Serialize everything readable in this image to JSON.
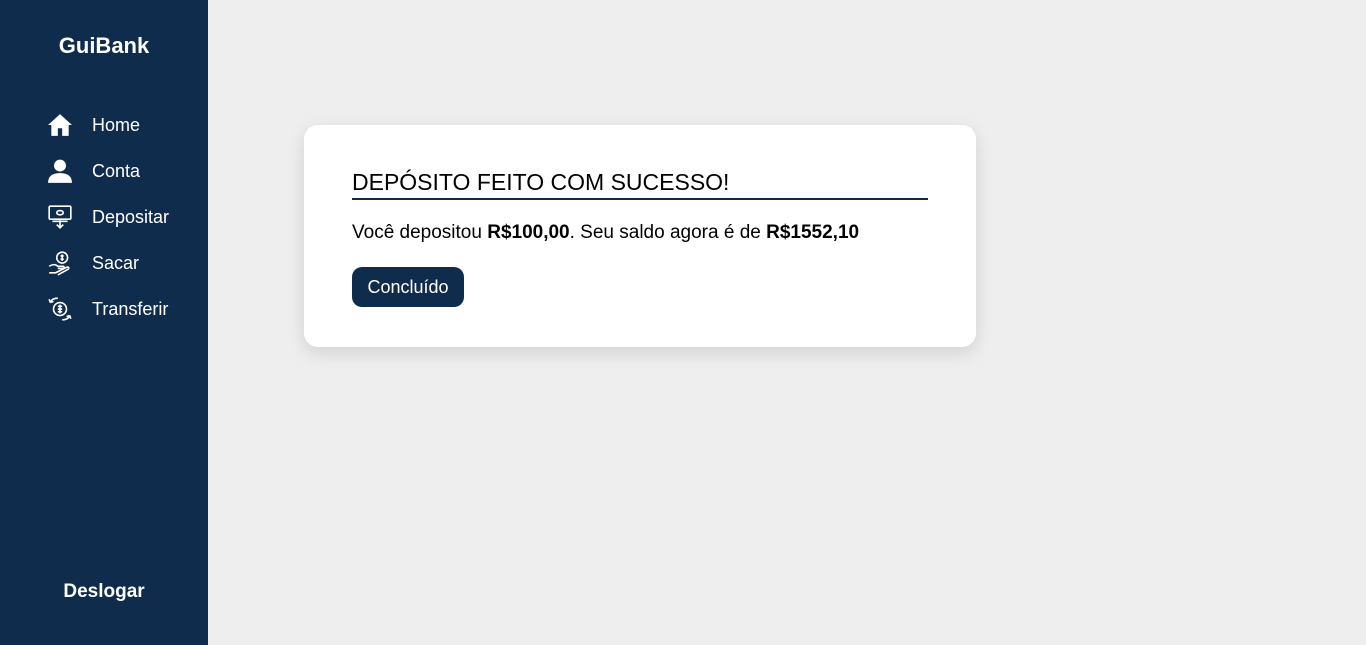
{
  "sidebar": {
    "brand": "GuiBank",
    "items": [
      {
        "label": "Home",
        "icon": "home-icon"
      },
      {
        "label": "Conta",
        "icon": "user-icon"
      },
      {
        "label": "Depositar",
        "icon": "deposit-icon"
      },
      {
        "label": "Sacar",
        "icon": "withdraw-icon"
      },
      {
        "label": "Transferir",
        "icon": "transfer-icon"
      }
    ],
    "logout": "Deslogar"
  },
  "modal": {
    "title": "DEPÓSITO FEITO COM SUCESSO!",
    "text_prefix": "Você depositou ",
    "amount": "R$100,00",
    "text_middle": ". Seu saldo agora é de ",
    "balance": "R$1552,10",
    "button": "Concluído"
  },
  "colors": {
    "sidebar_bg": "#102c4c",
    "page_bg": "#eeeeee",
    "card_bg": "#ffffff",
    "button_bg": "#102c4c"
  }
}
